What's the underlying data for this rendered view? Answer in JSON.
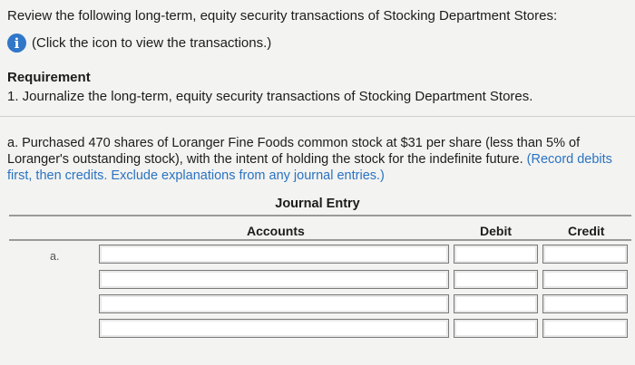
{
  "intro": "Review the following long-term, equity security transactions of Stocking Department Stores:",
  "info_link": "(Click the icon to view the transactions.)",
  "info_icon": "info-icon",
  "requirement": {
    "title": "Requirement",
    "text": "1. Journalize the long-term, equity security transactions of Stocking Department Stores."
  },
  "question": {
    "text": "a. Purchased 470 shares of Loranger Fine Foods common stock at $31 per share (less than 5% of Loranger's outstanding stock), with the intent of holding the stock for the indefinite future.",
    "note": "(Record debits first, then credits. Exclude explanations from any journal entries.)"
  },
  "journal": {
    "title": "Journal Entry",
    "columns": {
      "accounts": "Accounts",
      "debit": "Debit",
      "credit": "Credit"
    },
    "row_label": "a.",
    "rows": [
      {
        "account": "",
        "debit": "",
        "credit": ""
      },
      {
        "account": "",
        "debit": "",
        "credit": ""
      },
      {
        "account": "",
        "debit": "",
        "credit": ""
      },
      {
        "account": "",
        "debit": "",
        "credit": ""
      }
    ]
  },
  "colors": {
    "accent": "#2f77c9",
    "note": "#2a73c2",
    "background": "#f3f3f1"
  }
}
